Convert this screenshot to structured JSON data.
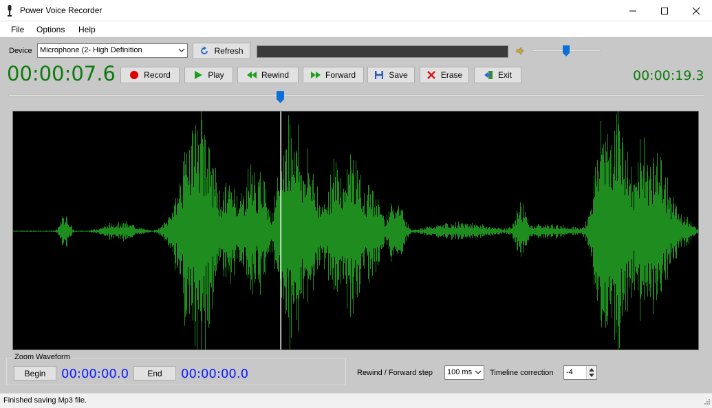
{
  "window": {
    "title": "Power Voice Recorder"
  },
  "menu": [
    "File",
    "Options",
    "Help"
  ],
  "device": {
    "label": "Device",
    "selected": "Microphone (2- High Definition",
    "refresh_label": "Refresh"
  },
  "volume": {
    "level": 0.5
  },
  "transport": {
    "current_time": "00:00:07.6",
    "total_time": "00:00:19.3",
    "position_fraction": 0.39,
    "buttons": {
      "record": "Record",
      "play": "Play",
      "rewind": "Rewind",
      "forward": "Forward",
      "save": "Save",
      "erase": "Erase",
      "exit": "Exit"
    }
  },
  "zoom": {
    "title": "Zoom Waveform",
    "begin_label": "Begin",
    "begin_time": "00:00:00.0",
    "end_label": "End",
    "end_time": "00:00:00.0"
  },
  "step": {
    "label": "Rewind / Forward step",
    "value": "100 ms"
  },
  "timeline": {
    "label": "Timeline correction",
    "value": "-4"
  },
  "status": {
    "text": "Finished saving Mp3 file."
  },
  "colors": {
    "waveform": "#1e8c1e",
    "time_green": "#0d7a0d",
    "time_blue": "#0a19ff",
    "record_red": "#e00000",
    "play_green": "#1aa01a",
    "accent": "#0a6fd6"
  }
}
